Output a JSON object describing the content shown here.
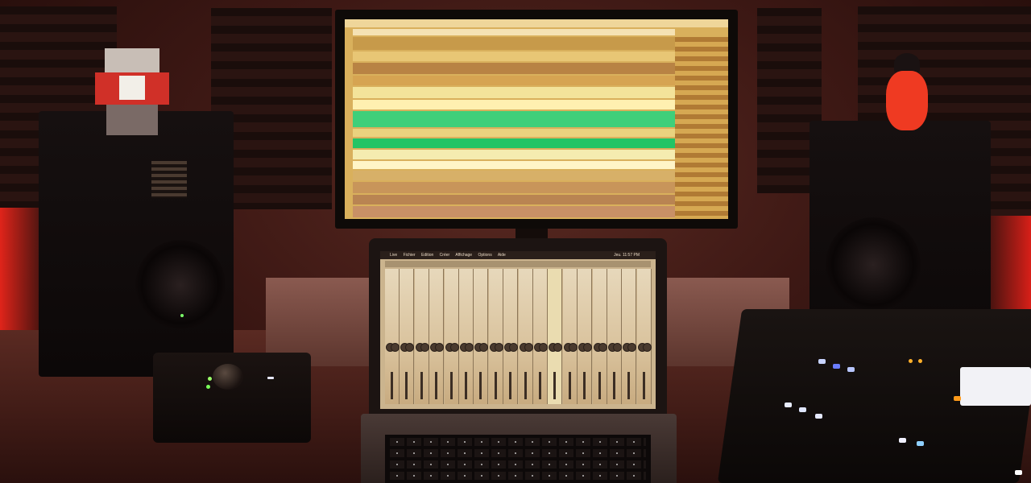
{
  "scene": {
    "description_colors": {
      "wall": "#3d1814",
      "red_glow": "#e0241a",
      "monitor_screen": "#d9b05c",
      "track_green": "#23c465",
      "laptop_screen": "#cbb48e"
    }
  },
  "laptop": {
    "menubar": {
      "apple": "",
      "items": [
        "Live",
        "Fichier",
        "Edition",
        "Créer",
        "Affichage",
        "Options",
        "Aide"
      ],
      "clock": "Jeu. 11:57 PM"
    }
  }
}
